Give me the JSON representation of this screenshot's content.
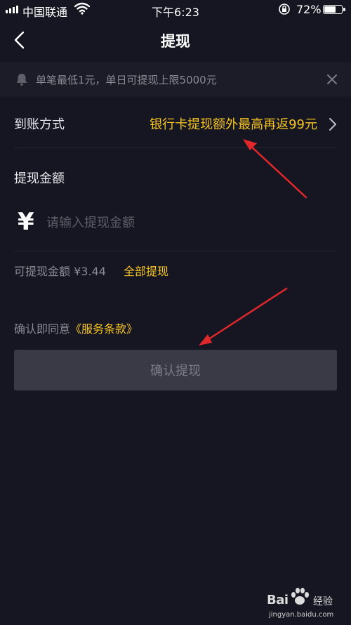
{
  "status_bar": {
    "carrier": "中国联通",
    "time": "下午6:23",
    "battery_percent": "72%",
    "battery_level": 0.72
  },
  "nav": {
    "title": "提现",
    "back_icon": "chevron-left-icon"
  },
  "notice": {
    "icon": "bell-icon",
    "text": "单笔最低1元，单日可提现上限5000元",
    "close_icon": "close-icon"
  },
  "withdraw_method": {
    "label": "到账方式",
    "value": "银行卡提现额外最高再返99元",
    "chevron_icon": "chevron-right-icon"
  },
  "amount": {
    "label": "提现金额",
    "currency_symbol": "¥",
    "placeholder": "请输入提现金额",
    "value": ""
  },
  "available": {
    "text": "可提现金额 ¥3.44",
    "all_link": "全部提现"
  },
  "agreement": {
    "prefix": "确认即同意",
    "terms": "《服务条款》"
  },
  "confirm_button": {
    "label": "确认提现"
  },
  "watermark": {
    "brand": "Bai",
    "product": "经验",
    "domain": "jingyan.baidu.com"
  },
  "colors": {
    "background": "#161622",
    "accent": "#f5c420",
    "annotation_arrow": "#e0282a",
    "button_disabled": "#393a45"
  }
}
